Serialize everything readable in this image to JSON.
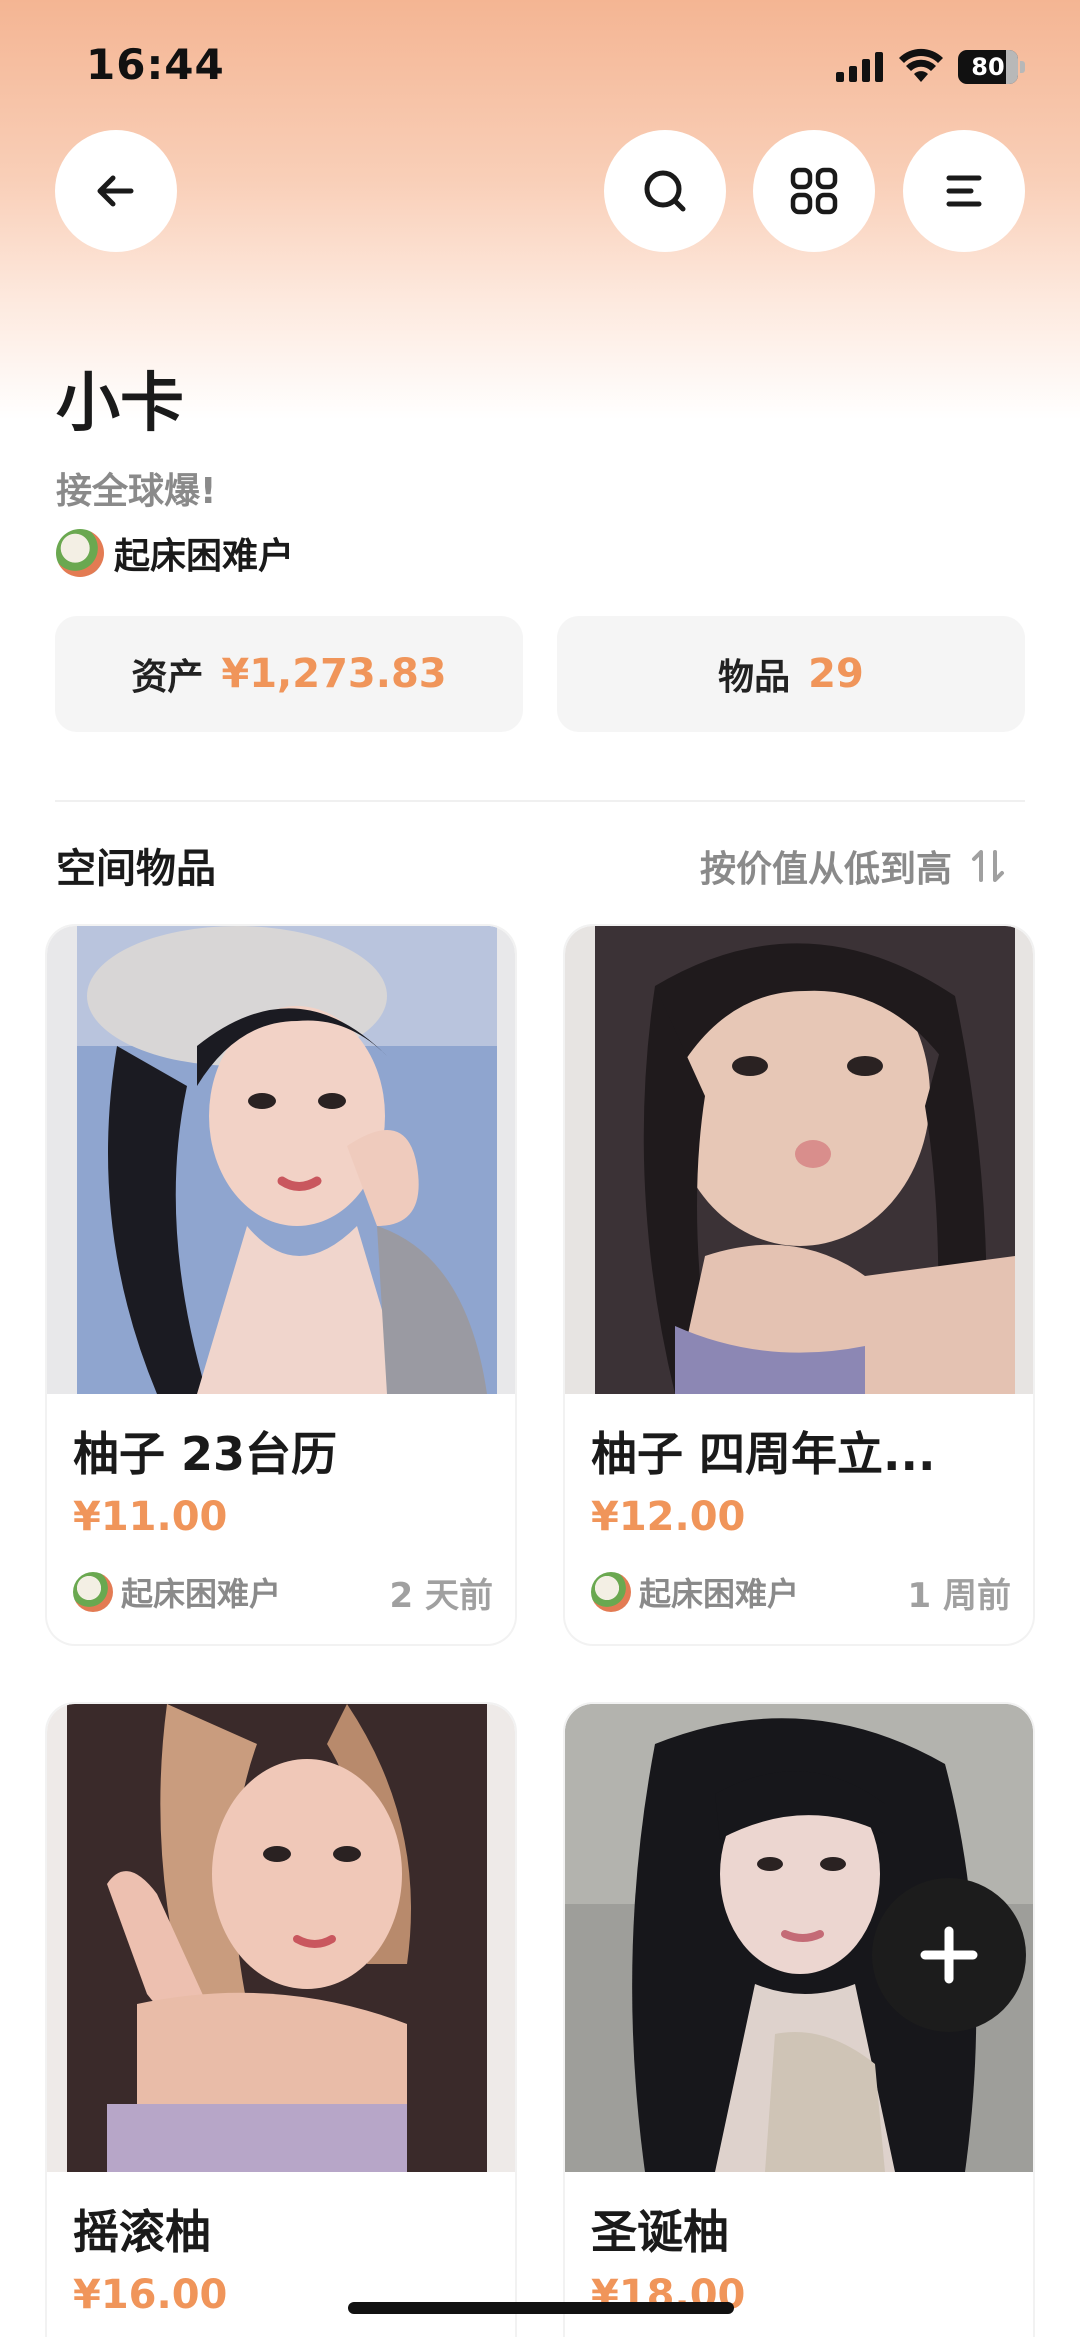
{
  "status_bar": {
    "time": "16:44",
    "battery_level": "80",
    "battery_fraction": 0.8
  },
  "nav": {
    "back_icon": "arrow-left-icon",
    "search_icon": "search-icon",
    "grid_icon": "grid-icon",
    "menu_icon": "menu-lines-icon"
  },
  "header": {
    "title": "小卡",
    "subtitle": "接全球爆!",
    "owner_name": "起床困难户"
  },
  "stats": {
    "assets_label": "资产",
    "assets_value": "¥1,273.83",
    "items_label": "物品",
    "items_value": "29"
  },
  "section": {
    "title": "空间物品",
    "sort_label": "按价值从低到高",
    "sort_icon": "sort-arrows-icon"
  },
  "items": [
    {
      "name": "柚子 23台历",
      "price": "¥11.00",
      "owner": "起床困难户",
      "time": "2 天前"
    },
    {
      "name": "柚子 四周年立...",
      "price": "¥12.00",
      "owner": "起床困难户",
      "time": "1 周前"
    },
    {
      "name": "摇滚柚",
      "price": "¥16.00"
    },
    {
      "name": "圣诞柚",
      "price": "¥18.00"
    }
  ],
  "fab_icon": "plus-icon",
  "colors": {
    "accent": "#f0955a",
    "header_gradient_top": "#f4b593",
    "text_primary": "#1a1a1a",
    "text_secondary": "#8a8a8a",
    "stat_bg": "#f5f5f5",
    "fab_bg": "#1c1c1c"
  }
}
